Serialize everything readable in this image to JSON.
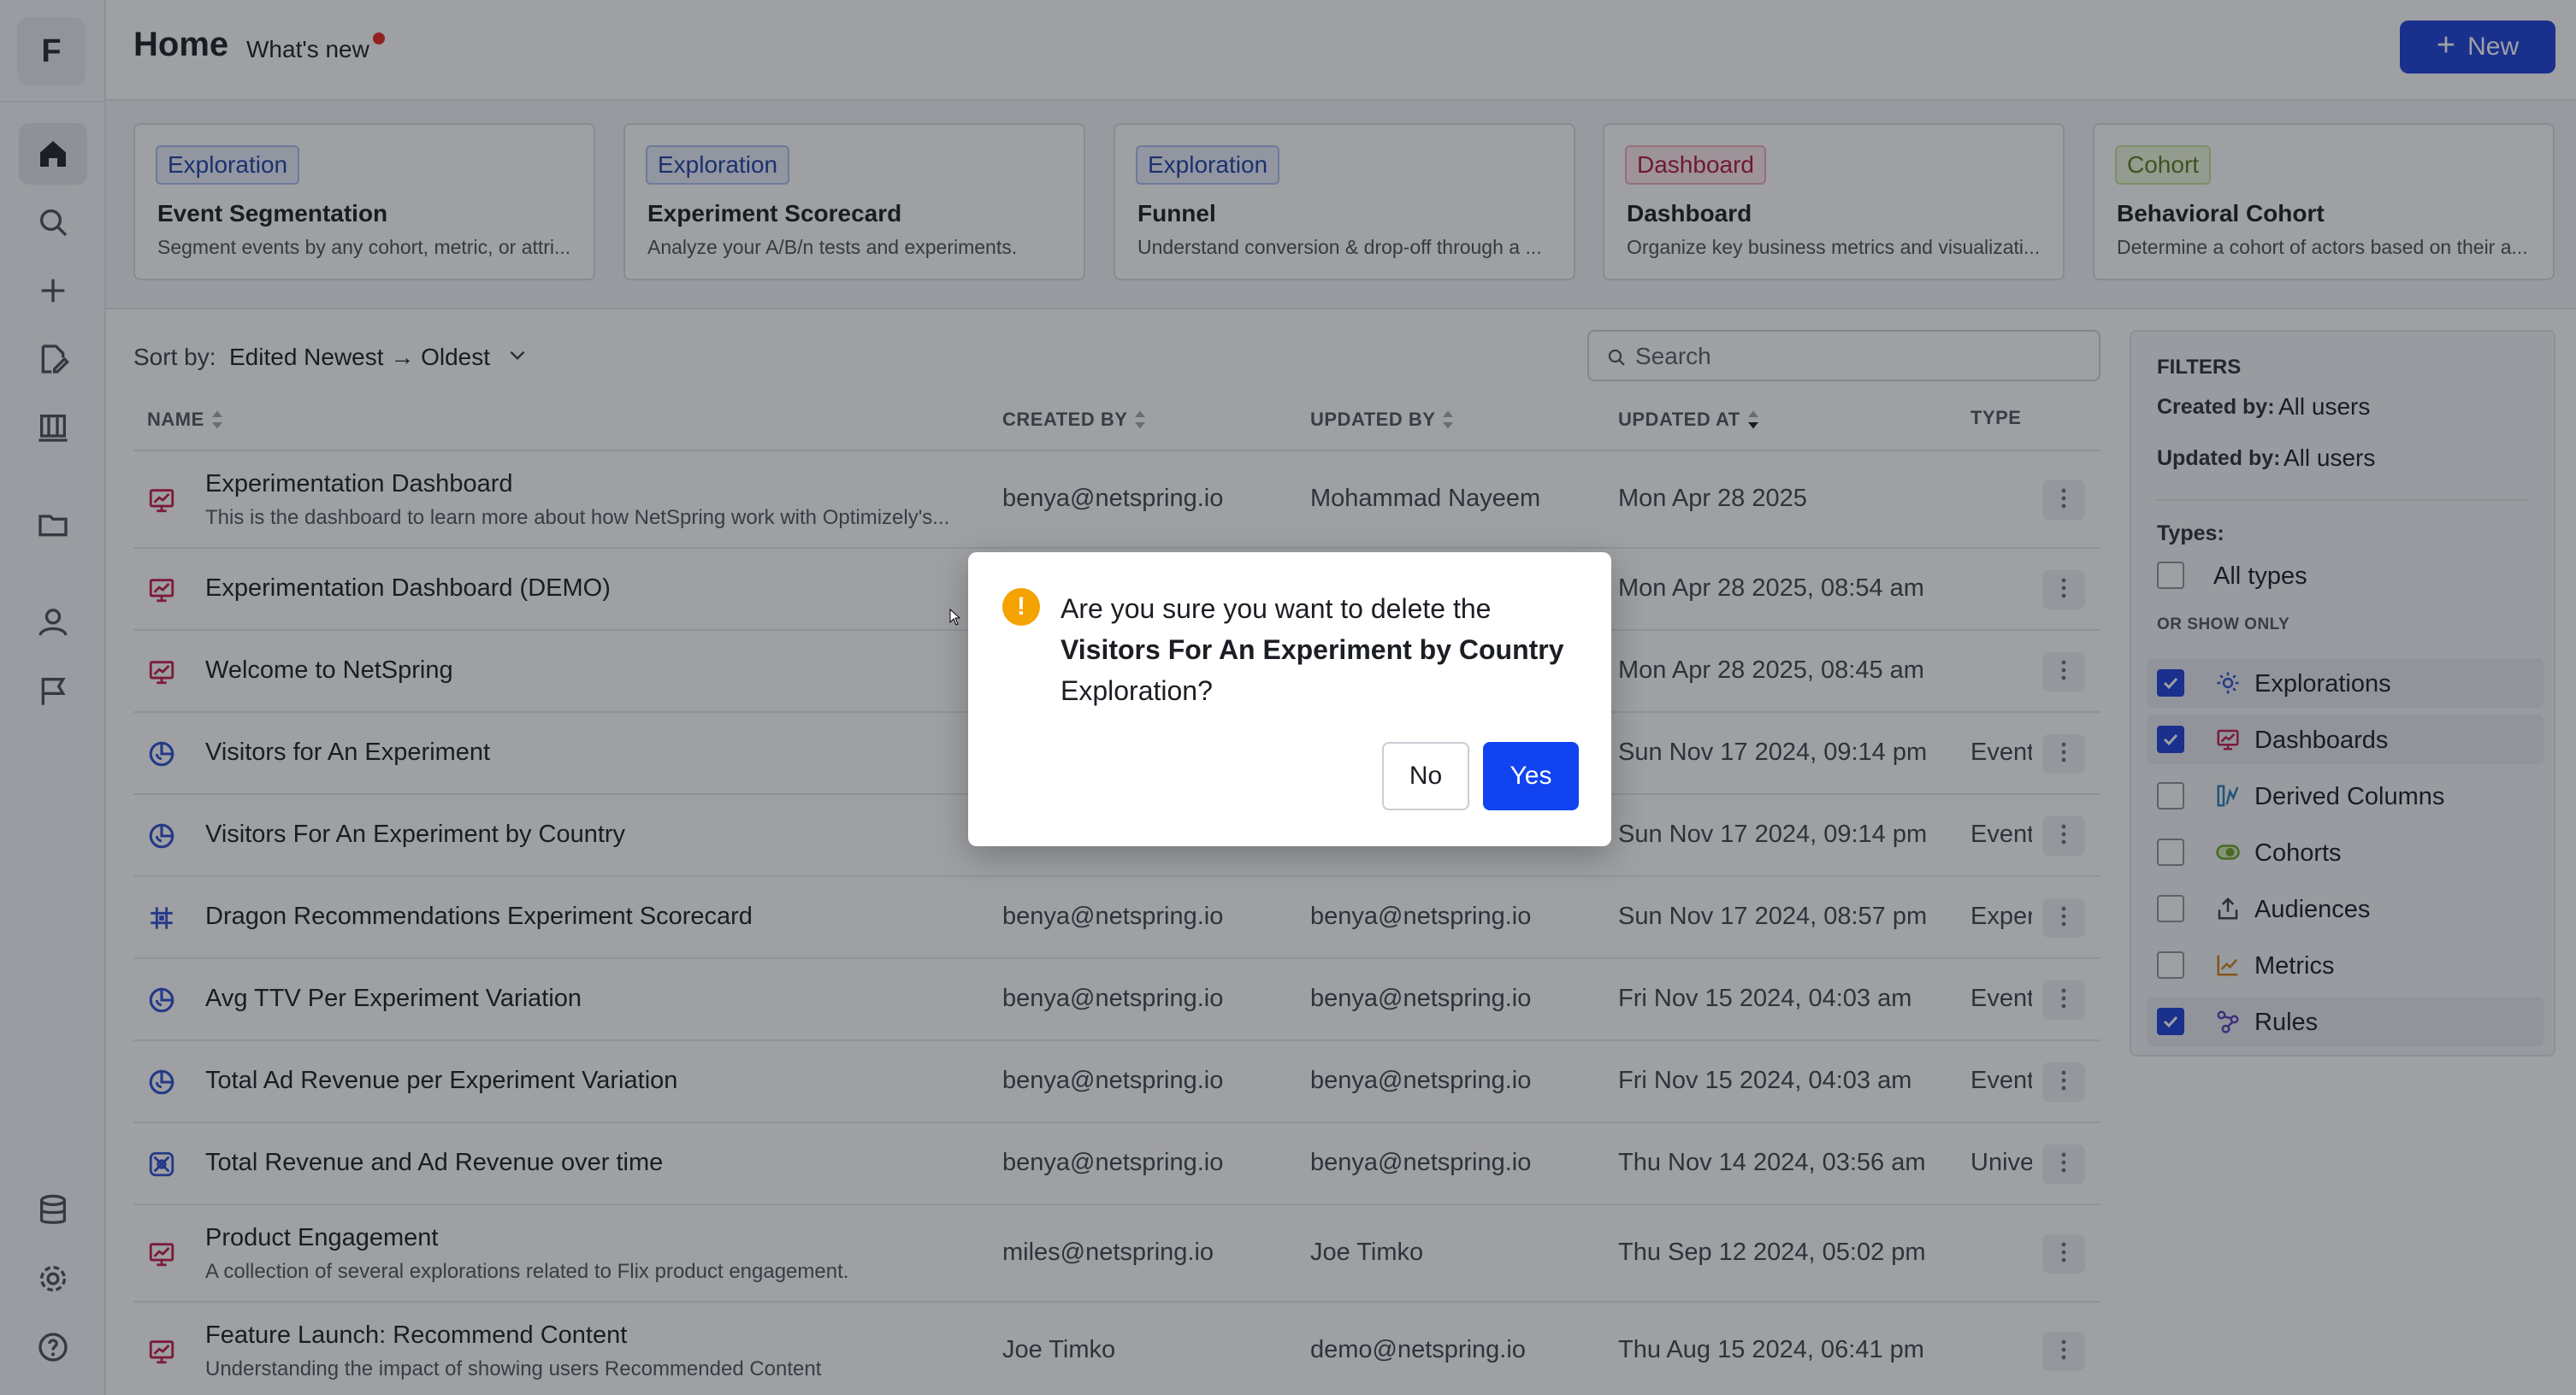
{
  "rail": {
    "logo": "F",
    "items": [
      {
        "icon": "home-icon",
        "active": true
      },
      {
        "icon": "search-icon"
      },
      {
        "icon": "plus-icon"
      },
      {
        "icon": "edit-icon"
      },
      {
        "icon": "library-icon"
      },
      {
        "icon": "folder-icon"
      },
      {
        "icon": "user-icon"
      },
      {
        "icon": "flag-icon"
      }
    ],
    "bottom_items": [
      {
        "icon": "database-icon"
      },
      {
        "icon": "gear-icon"
      },
      {
        "icon": "help-icon"
      }
    ]
  },
  "header": {
    "title": "Home",
    "whats_new": "What's new",
    "new_button": "New"
  },
  "cards": [
    {
      "badge": "Exploration",
      "badge_kind": "exploration",
      "title": "Event Segmentation",
      "desc": "Segment events by any cohort, metric, or attri..."
    },
    {
      "badge": "Exploration",
      "badge_kind": "exploration",
      "title": "Experiment Scorecard",
      "desc": "Analyze your A/B/n tests and experiments."
    },
    {
      "badge": "Exploration",
      "badge_kind": "exploration",
      "title": "Funnel",
      "desc": "Understand conversion & drop-off through a ..."
    },
    {
      "badge": "Dashboard",
      "badge_kind": "dashboard",
      "title": "Dashboard",
      "desc": "Organize key business metrics and visualizati..."
    },
    {
      "badge": "Cohort",
      "badge_kind": "cohort",
      "title": "Behavioral Cohort",
      "desc": "Determine a cohort of actors based on their a..."
    }
  ],
  "sort": {
    "label": "Sort by:",
    "value": "Edited Newest → Oldest"
  },
  "search": {
    "placeholder": "Search",
    "value": ""
  },
  "table": {
    "columns": [
      "NAME",
      "CREATED BY",
      "UPDATED BY",
      "UPDATED AT",
      "TYPE"
    ],
    "rows": [
      {
        "icon": "dashboard-icon",
        "name": "Experimentation Dashboard",
        "desc": "This is the dashboard to learn more about how NetSpring work with Optimizely's...",
        "created_by": "benya@netspring.io",
        "updated_by": "Mohammad Nayeem",
        "updated_at": "Mon Apr 28 2025",
        "type": ""
      },
      {
        "icon": "dashboard-icon",
        "name": "Experimentation Dashboard (DEMO)",
        "desc": "",
        "created_by": "",
        "updated_by": "",
        "updated_at": "Mon Apr 28 2025, 08:54 am",
        "type": ""
      },
      {
        "icon": "dashboard-icon",
        "name": "Welcome to NetSpring",
        "desc": "",
        "created_by": "",
        "updated_by": "",
        "updated_at": "Mon Apr 28 2025, 08:45 am",
        "type": ""
      },
      {
        "icon": "segmentation-icon",
        "name": "Visitors for An Experiment",
        "desc": "",
        "created_by": "",
        "updated_by": "",
        "updated_at": "Sun Nov 17 2024, 09:14 pm",
        "type": "Event"
      },
      {
        "icon": "segmentation-icon",
        "name": "Visitors For An Experiment by Country",
        "desc": "",
        "created_by": "",
        "updated_by": "",
        "updated_at": "Sun Nov 17 2024, 09:14 pm",
        "type": "Event"
      },
      {
        "icon": "scorecard-icon",
        "name": "Dragon Recommendations Experiment Scorecard",
        "desc": "",
        "created_by": "benya@netspring.io",
        "updated_by": "benya@netspring.io",
        "updated_at": "Sun Nov 17 2024, 08:57 pm",
        "type": "Experi"
      },
      {
        "icon": "segmentation-icon",
        "name": "Avg TTV Per Experiment Variation",
        "desc": "",
        "created_by": "benya@netspring.io",
        "updated_by": "benya@netspring.io",
        "updated_at": "Fri Nov 15 2024, 04:03 am",
        "type": "Event"
      },
      {
        "icon": "segmentation-icon",
        "name": "Total Ad Revenue per Experiment Variation",
        "desc": "",
        "created_by": "benya@netspring.io",
        "updated_by": "benya@netspring.io",
        "updated_at": "Fri Nov 15 2024, 04:03 am",
        "type": "Event"
      },
      {
        "icon": "universal-icon",
        "name": "Total Revenue and Ad Revenue over time",
        "desc": "",
        "created_by": "benya@netspring.io",
        "updated_by": "benya@netspring.io",
        "updated_at": "Thu Nov 14 2024, 03:56 am",
        "type": "Univer"
      },
      {
        "icon": "dashboard-icon",
        "name": "Product Engagement",
        "desc": "A collection of several explorations related to Flix product engagement.",
        "created_by": "miles@netspring.io",
        "updated_by": "Joe Timko",
        "updated_at": "Thu Sep 12 2024, 05:02 pm",
        "type": ""
      },
      {
        "icon": "dashboard-icon",
        "name": "Feature Launch: Recommend Content",
        "desc": "Understanding the impact of showing users Recommended Content",
        "created_by": "Joe Timko",
        "updated_by": "demo@netspring.io",
        "updated_at": "Thu Aug 15 2024, 06:41 pm",
        "type": ""
      }
    ]
  },
  "filters": {
    "title": "FILTERS",
    "created_by_label": "Created by:",
    "created_by_value": "All users",
    "updated_by_label": "Updated by:",
    "updated_by_value": "All users",
    "types_label": "Types:",
    "all_types": "All types",
    "or_show_only": "OR SHOW ONLY",
    "options": [
      {
        "label": "Explorations",
        "checked": true,
        "icon": "exploration-icon",
        "color": "#2f4fd0"
      },
      {
        "label": "Dashboards",
        "checked": true,
        "icon": "dashboard-icon",
        "color": "#c41a4a"
      },
      {
        "label": "Derived Columns",
        "checked": false,
        "icon": "derived-column-icon",
        "color": "#2a7fb8"
      },
      {
        "label": "Cohorts",
        "checked": false,
        "icon": "cohort-icon",
        "color": "#6aa12a"
      },
      {
        "label": "Audiences",
        "checked": false,
        "icon": "audience-icon",
        "color": "#3a3f47"
      },
      {
        "label": "Metrics",
        "checked": false,
        "icon": "metric-icon",
        "color": "#d2801a"
      },
      {
        "label": "Rules",
        "checked": true,
        "icon": "rule-icon",
        "color": "#5b3fb8"
      }
    ]
  },
  "dialog": {
    "line1": "Are you sure you want to delete the",
    "item_name": "Visitors For An Experiment by Country",
    "line3": "Exploration?",
    "no": "No",
    "yes": "Yes"
  },
  "colors": {
    "accent": "#1a3fd9",
    "dashboard_icon": "#c41a4a",
    "exploration_icon": "#2f4fd0",
    "warning": "#f4a300"
  }
}
